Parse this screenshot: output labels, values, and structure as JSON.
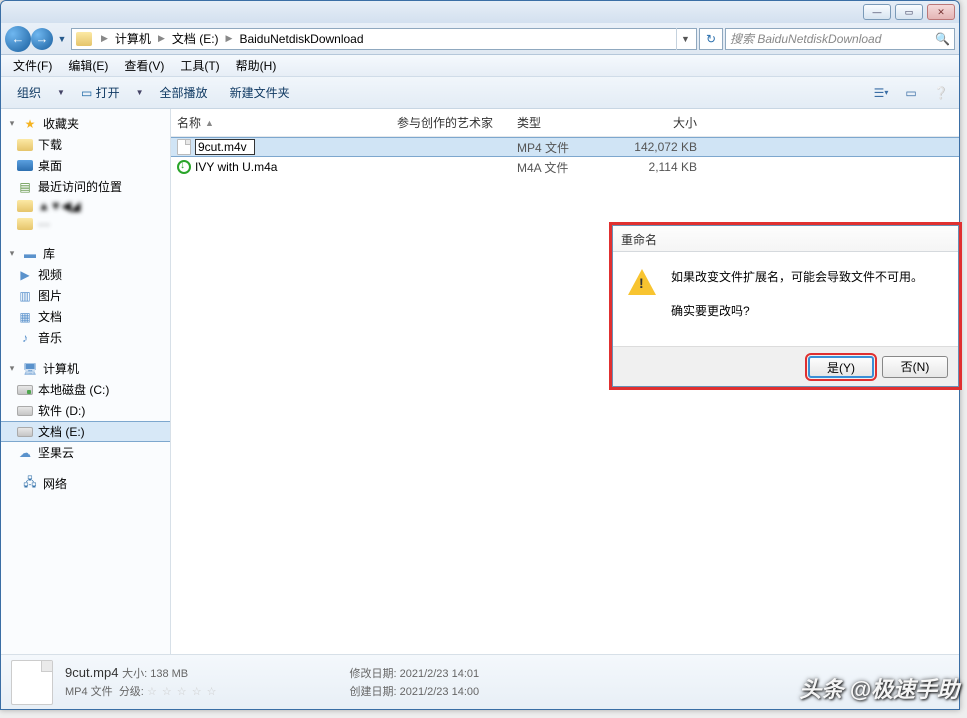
{
  "titlebar": {
    "min": "—",
    "max": "▭",
    "close": "✕"
  },
  "nav": {
    "back": "←",
    "fwd": "→"
  },
  "breadcrumb": {
    "computer": "计算机",
    "drive": "文档 (E:)",
    "folder": "BaiduNetdiskDownload"
  },
  "search": {
    "placeholder": "搜索 BaiduNetdiskDownload",
    "icon": "🔍"
  },
  "menu": {
    "file": "文件(F)",
    "edit": "编辑(E)",
    "view": "查看(V)",
    "tools": "工具(T)",
    "help": "帮助(H)"
  },
  "toolbar": {
    "organize": "组织",
    "open": "打开",
    "playall": "全部播放",
    "newfolder": "新建文件夹"
  },
  "tree": {
    "favorites": "收藏夹",
    "downloads": "下载",
    "desktop": "桌面",
    "recent": "最近访问的位置",
    "libraries": "库",
    "videos": "视频",
    "pictures": "图片",
    "documents": "文档",
    "music": "音乐",
    "computer": "计算机",
    "localc": "本地磁盘 (C:)",
    "softwared": "软件 (D:)",
    "doce": "文档 (E:)",
    "jianguo": "坚果云",
    "network": "网络"
  },
  "columns": {
    "name": "名称",
    "artist": "参与创作的艺术家",
    "type": "类型",
    "size": "大小"
  },
  "files": [
    {
      "name": "9cut.m4v",
      "type": "MP4 文件",
      "size": "142,072 KB",
      "icon": "file",
      "renaming": true
    },
    {
      "name": "IVY with U.m4a",
      "type": "M4A 文件",
      "size": "2,114 KB",
      "icon": "m4a",
      "renaming": false
    }
  ],
  "details": {
    "filename": "9cut.mp4",
    "size_label": "大小:",
    "size": "138 MB",
    "type": "MP4 文件",
    "rating_label": "分级:",
    "modified_label": "修改日期:",
    "modified": "2021/2/23 14:01",
    "created_label": "创建日期:",
    "created": "2021/2/23 14:00"
  },
  "dialog": {
    "title": "重命名",
    "msg1": "如果改变文件扩展名，可能会导致文件不可用。",
    "msg2": "确实要更改吗?",
    "yes": "是(Y)",
    "no": "否(N)"
  },
  "watermark": "头条 @极速手助"
}
